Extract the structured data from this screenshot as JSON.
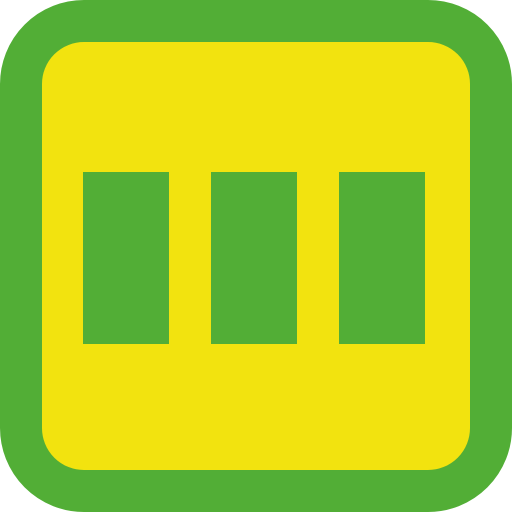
{
  "icon": {
    "name": "three-bars-icon",
    "colors": {
      "frame": "#52AE36",
      "fill": "#F2E30F",
      "bars": "#52AE36"
    },
    "bars": [
      {
        "id": "bar-1"
      },
      {
        "id": "bar-2"
      },
      {
        "id": "bar-3"
      }
    ]
  }
}
